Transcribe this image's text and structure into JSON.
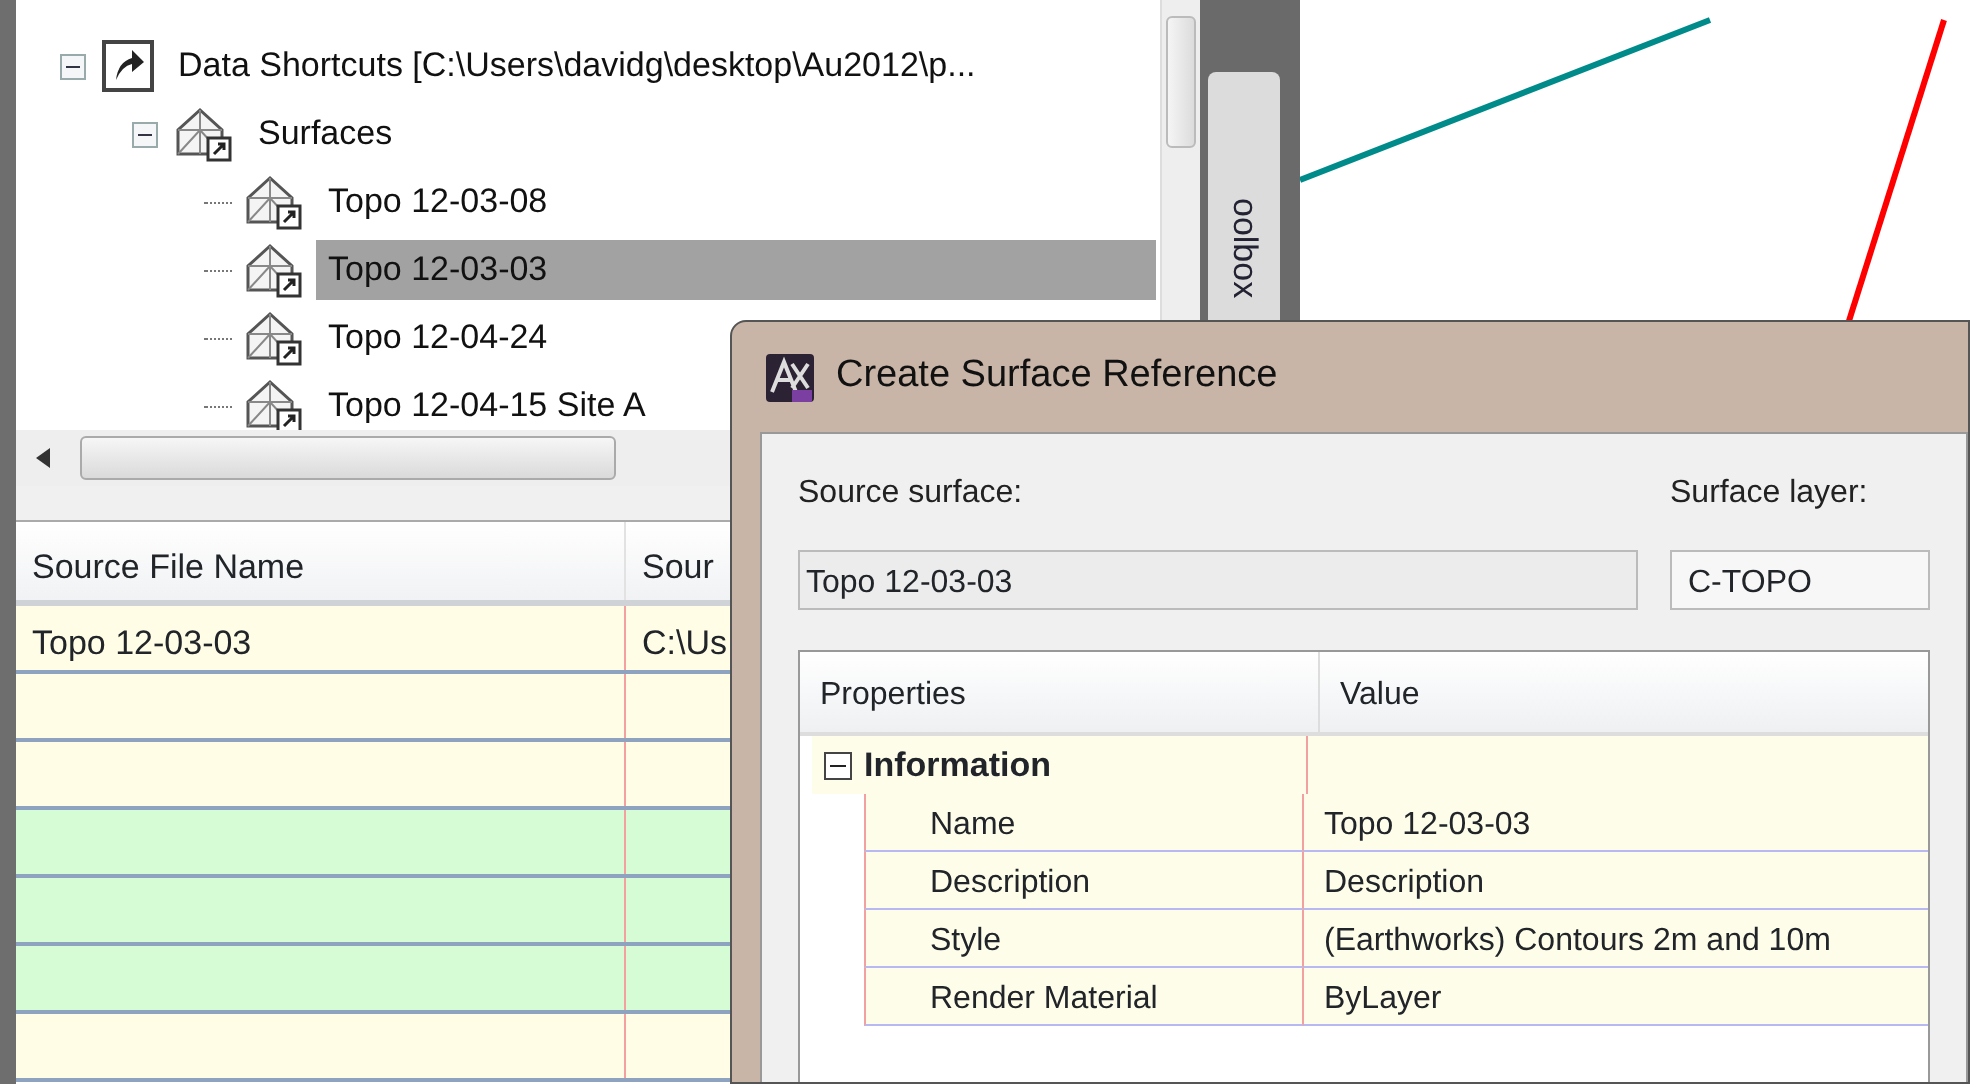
{
  "tree": {
    "items": [
      {
        "label": "Data Shortcuts [C:\\Users\\davidg\\desktop\\Au2012\\p...",
        "kind": "shortcut",
        "expanded": true,
        "selected": false,
        "children": [
          {
            "label": "Surfaces",
            "kind": "surface",
            "expanded": true,
            "selected": false,
            "children": [
              {
                "label": "Topo 12-03-08",
                "kind": "surface",
                "selected": false
              },
              {
                "label": "Topo 12-03-03",
                "kind": "surface",
                "selected": true
              },
              {
                "label": "Topo 12-04-24",
                "kind": "surface",
                "selected": false
              },
              {
                "label": "Topo 12-04-15 Site A",
                "kind": "surface",
                "selected": false
              }
            ]
          }
        ]
      }
    ]
  },
  "side_tab": {
    "label": "oolbox"
  },
  "table": {
    "columns": [
      "Source File Name",
      "Sour"
    ],
    "rows": [
      {
        "cells": [
          "Topo 12-03-03",
          "C:\\Us"
        ],
        "color": "#fffde6"
      },
      {
        "color": "#fffde6"
      },
      {
        "color": "#fffde6"
      },
      {
        "color": "#d6fcd6"
      },
      {
        "color": "#d6fcd6"
      },
      {
        "color": "#d6fcd6"
      },
      {
        "color": "#fffde6"
      }
    ]
  },
  "dialog": {
    "title": "Create Surface Reference",
    "source_surface": {
      "label": "Source surface:",
      "value": "Topo 12-03-03"
    },
    "surface_layer": {
      "label": "Surface layer:",
      "value": "C-TOPO"
    },
    "properties": {
      "columns": [
        "Properties",
        "Value"
      ],
      "groups": [
        {
          "label": "Information",
          "expanded": true,
          "rows": [
            {
              "name": "Name",
              "value": "Topo 12-03-03"
            },
            {
              "name": "Description",
              "value": "Description"
            },
            {
              "name": "Style",
              "value": "(Earthworks) Contours 2m and 10m"
            },
            {
              "name": "Render Material",
              "value": "ByLayer"
            }
          ]
        }
      ]
    }
  }
}
